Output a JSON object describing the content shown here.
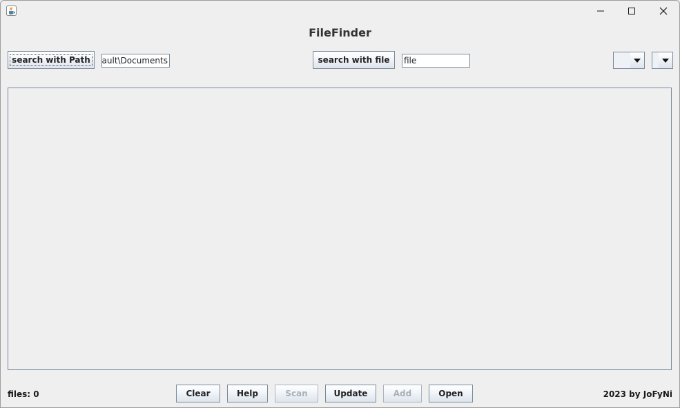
{
  "window": {
    "icon": "java-cup-icon",
    "controls": [
      "minimize-icon",
      "maximize-icon",
      "close-icon"
    ]
  },
  "app": {
    "title": "FileFinder"
  },
  "search": {
    "path_button": "search with Path",
    "path_value": "efault\\Documents",
    "file_button": "search with file",
    "file_value": "file"
  },
  "combos": [
    {
      "selected": ""
    },
    {
      "selected": ""
    }
  ],
  "toolbar": {
    "clear": "Clear",
    "help": "Help",
    "scan": "Scan",
    "update": "Update",
    "add": "Add",
    "open": "Open"
  },
  "status": {
    "files": "files: 0",
    "credit": "2023 by JoFyNi"
  }
}
